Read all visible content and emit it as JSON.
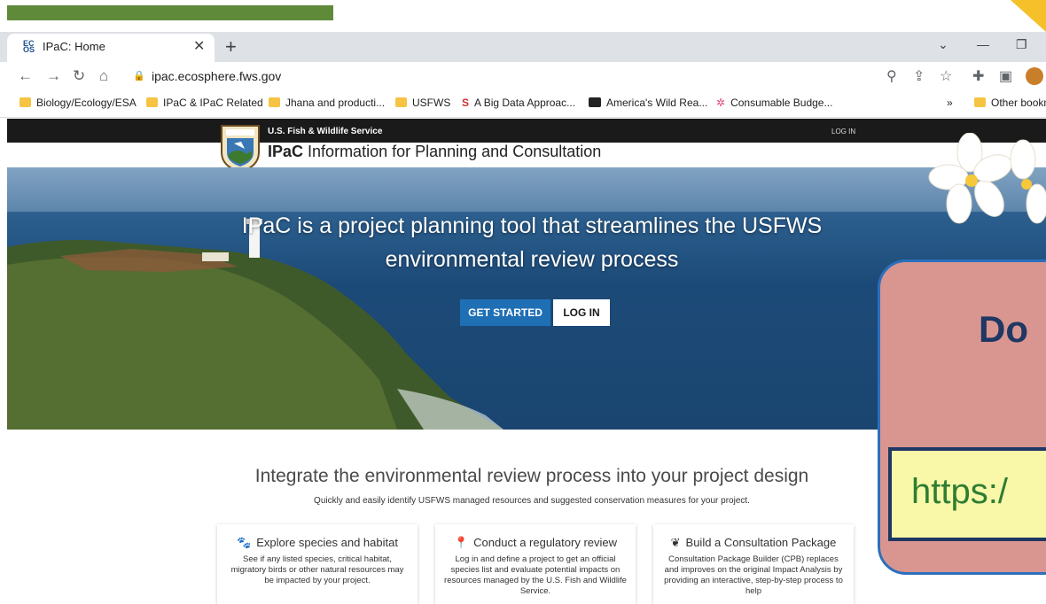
{
  "browser": {
    "tab_title": "IPaC: Home",
    "tab_favicon_text": "EC\nOS",
    "url": "ipac.ecosphere.fws.gov",
    "bookmarks": [
      {
        "label": "Biology/Ecology/ESA",
        "icon": "folder-icon"
      },
      {
        "label": "IPaC & IPaC Related",
        "icon": "folder-icon"
      },
      {
        "label": "Jhana and producti...",
        "icon": "folder-icon"
      },
      {
        "label": "USFWS",
        "icon": "folder-icon"
      },
      {
        "label": "A Big Data Approac...",
        "icon": "s-logo-icon"
      },
      {
        "label": "America's Wild Rea...",
        "icon": "media-icon"
      },
      {
        "label": "Consumable Budge...",
        "icon": "pinwheel-icon"
      }
    ],
    "more_bookmarks": "»",
    "other_bookmarks": "Other bookm"
  },
  "site": {
    "agency": "U.S. Fish & Wildlife Service",
    "login_small": "LOG IN",
    "brand": "IPaC",
    "brand_sub": "Information for Planning and Consultation",
    "hero_line1": "IPaC is a project planning tool that streamlines the USFWS",
    "hero_line2": "environmental review process",
    "get_started": "GET STARTED",
    "login_button": "LOG IN",
    "integrate_heading": "Integrate the environmental review process into your project design",
    "integrate_sub": "Quickly and easily identify USFWS managed resources and suggested conservation measures for your project.",
    "cards": [
      {
        "title": "Explore species and habitat",
        "icon": "paw-icon",
        "body": "See if any listed species, critical habitat, migratory birds or other natural resources may be impacted by your project."
      },
      {
        "title": "Conduct a regulatory review",
        "icon": "map-pin-icon",
        "body": "Log in and define a project to get an official species list and evaluate potential impacts on resources managed by the U.S. Fish and Wildlife Service."
      },
      {
        "title": "Build a Consultation Package",
        "icon": "leaf-icon",
        "body": "Consultation Package Builder (CPB) replaces and improves on the original Impact Analysis by providing an interactive, step-by-step process to help"
      }
    ]
  },
  "overlay": {
    "heading": "Do",
    "url_fragment": "https:/"
  },
  "colors": {
    "brand_blue": "#1f6fb5",
    "overlay_pink": "#d99690",
    "overlay_border": "#2c6fbd"
  }
}
